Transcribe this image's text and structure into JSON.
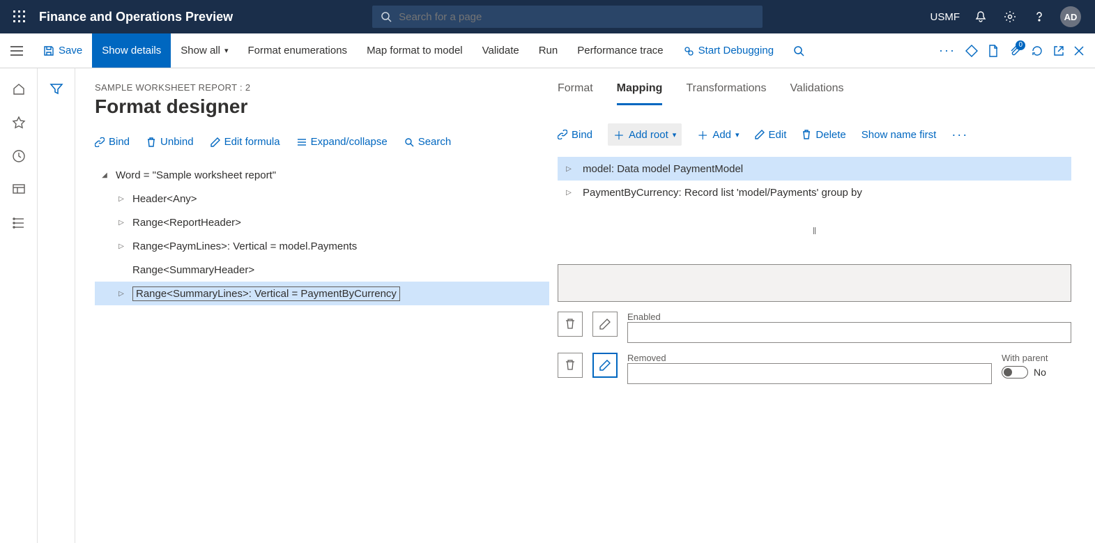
{
  "topbar": {
    "app_title": "Finance and Operations Preview",
    "search_placeholder": "Search for a page",
    "company": "USMF",
    "avatar_initials": "AD"
  },
  "actionbar": {
    "save": "Save",
    "show_details": "Show details",
    "show_all": "Show all",
    "format_enum": "Format enumerations",
    "map_format": "Map format to model",
    "validate": "Validate",
    "run": "Run",
    "perf_trace": "Performance trace",
    "start_debug": "Start Debugging"
  },
  "page": {
    "breadcrumb": "SAMPLE WORKSHEET REPORT : 2",
    "title": "Format designer"
  },
  "ltoolbar": {
    "bind": "Bind",
    "unbind": "Unbind",
    "edit_formula": "Edit formula",
    "expand": "Expand/collapse",
    "search": "Search"
  },
  "tree": {
    "root": "Word = \"Sample worksheet report\"",
    "n1": "Header<Any>",
    "n2": "Range<ReportHeader>",
    "n3": "Range<PaymLines>: Vertical = model.Payments",
    "n4": "Range<SummaryHeader>",
    "n5": "Range<SummaryLines>: Vertical = PaymentByCurrency"
  },
  "tabs": {
    "format": "Format",
    "mapping": "Mapping",
    "transformations": "Transformations",
    "validations": "Validations"
  },
  "rtoolbar": {
    "bind": "Bind",
    "add_root": "Add root",
    "add": "Add",
    "edit": "Edit",
    "delete": "Delete",
    "show_name_first": "Show name first"
  },
  "maptree": {
    "r1": "model: Data model PaymentModel",
    "r2": "PaymentByCurrency: Record list 'model/Payments' group by"
  },
  "props": {
    "enabled_label": "Enabled",
    "removed_label": "Removed",
    "with_parent_label": "With parent",
    "with_parent_value": "No"
  },
  "badge_count": "0"
}
